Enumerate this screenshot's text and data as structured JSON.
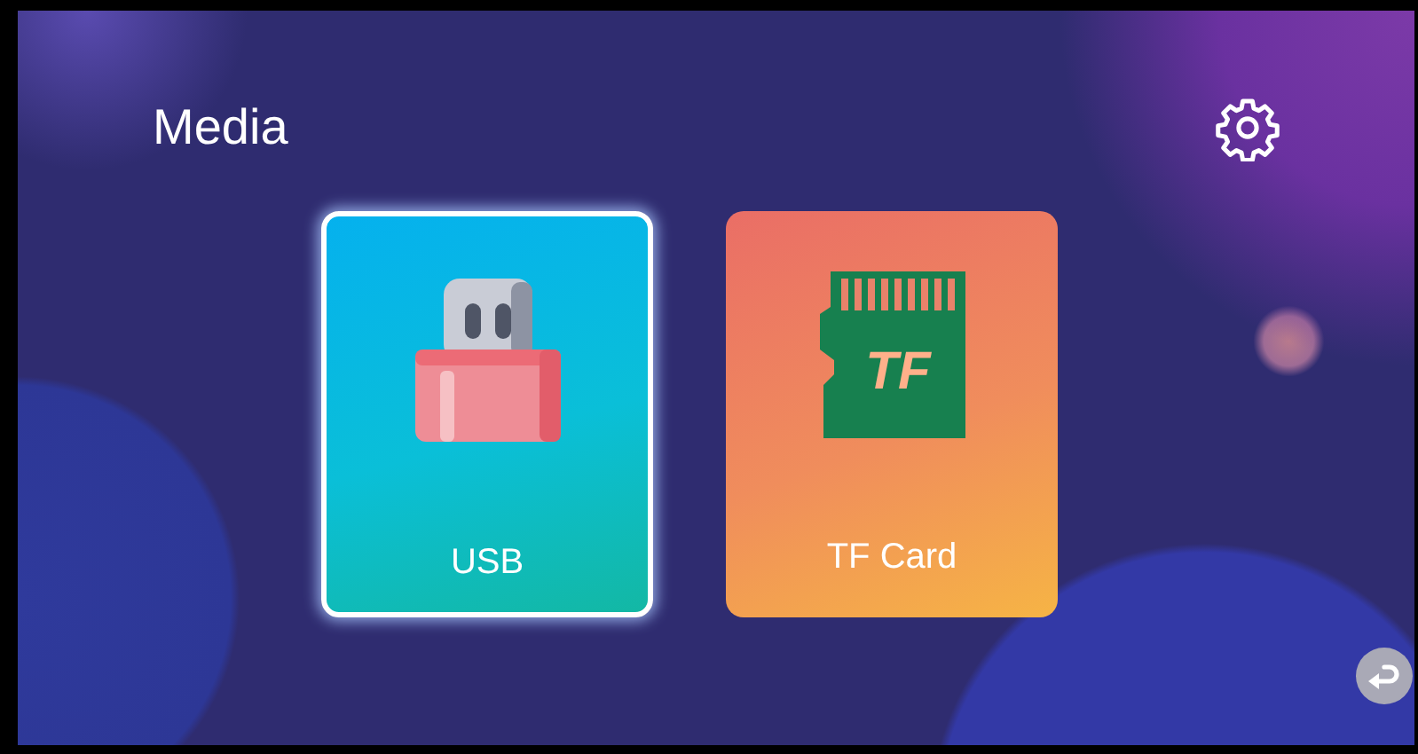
{
  "title": "Media",
  "sources": [
    {
      "kind": "usb",
      "label": "USB",
      "selected": true
    },
    {
      "kind": "tf",
      "label": "TF Card",
      "icon_text": "TF",
      "selected": false
    }
  ]
}
